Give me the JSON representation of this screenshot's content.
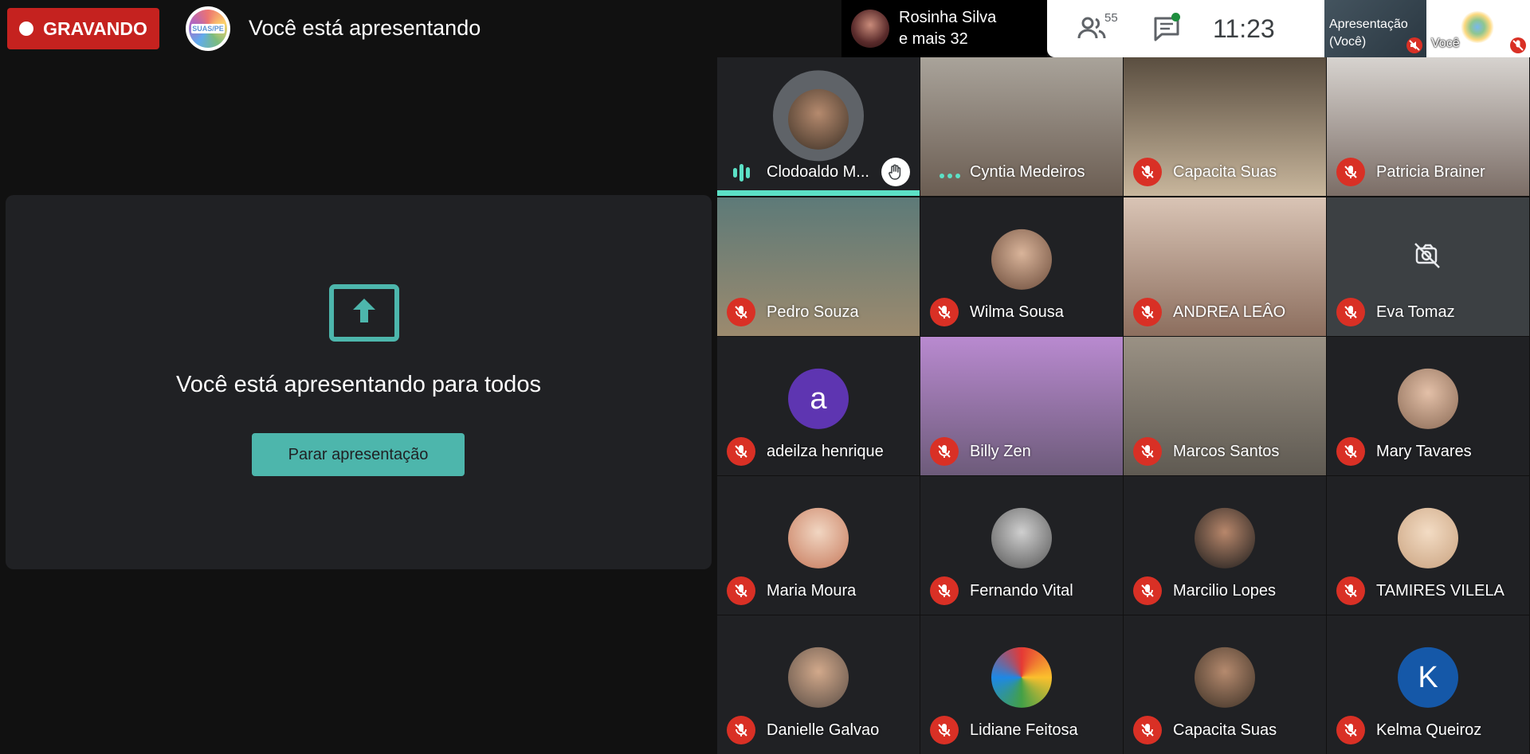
{
  "recording": {
    "label": "GRAVANDO"
  },
  "header": {
    "title": "Você está apresentando",
    "logo_text": "SUAS/PE"
  },
  "presenters": {
    "name": "Rosinha Silva",
    "more": "e mais 32"
  },
  "toolbar": {
    "participants_count": "55",
    "time": "11:23"
  },
  "self_tiles": [
    {
      "label_line1": "Apresentação",
      "label_line2": "(Você)"
    },
    {
      "label": "Você"
    }
  ],
  "presentation_panel": {
    "message": "Você está apresentando para todos",
    "stop_button": "Parar apresentação"
  },
  "participants": [
    {
      "name": "Clodoaldo M...",
      "state": "speaking",
      "type": "avatar",
      "hand_raised": true
    },
    {
      "name": "Cyntia Medeiros",
      "state": "audio",
      "type": "video"
    },
    {
      "name": "Capacita Suas",
      "state": "muted",
      "type": "video"
    },
    {
      "name": "Patricia Brainer",
      "state": "muted",
      "type": "video"
    },
    {
      "name": "Pedro Souza",
      "state": "muted",
      "type": "video"
    },
    {
      "name": "Wilma Sousa",
      "state": "muted",
      "type": "avatar"
    },
    {
      "name": "ANDREA LEÂO",
      "state": "muted",
      "type": "video"
    },
    {
      "name": "Eva Tomaz",
      "state": "muted",
      "type": "camera-off"
    },
    {
      "name": "adeilza henrique",
      "state": "muted",
      "type": "letter",
      "letter": "a",
      "color": "#5e35b1"
    },
    {
      "name": "Billy Zen",
      "state": "muted",
      "type": "video"
    },
    {
      "name": "Marcos Santos",
      "state": "muted",
      "type": "video"
    },
    {
      "name": "Mary Tavares",
      "state": "muted",
      "type": "avatar"
    },
    {
      "name": "Maria Moura",
      "state": "muted",
      "type": "avatar"
    },
    {
      "name": "Fernando Vital",
      "state": "muted",
      "type": "avatar"
    },
    {
      "name": "Marcilio Lopes",
      "state": "muted",
      "type": "avatar"
    },
    {
      "name": "TAMIRES VILELA",
      "state": "muted",
      "type": "avatar"
    },
    {
      "name": "Danielle Galvao",
      "state": "muted",
      "type": "avatar"
    },
    {
      "name": "Lidiane Feitosa",
      "state": "muted",
      "type": "avatar"
    },
    {
      "name": "Capacita Suas",
      "state": "muted",
      "type": "avatar"
    },
    {
      "name": "Kelma Queiroz",
      "state": "muted",
      "type": "letter",
      "letter": "K",
      "color": "#1558a8"
    }
  ]
}
